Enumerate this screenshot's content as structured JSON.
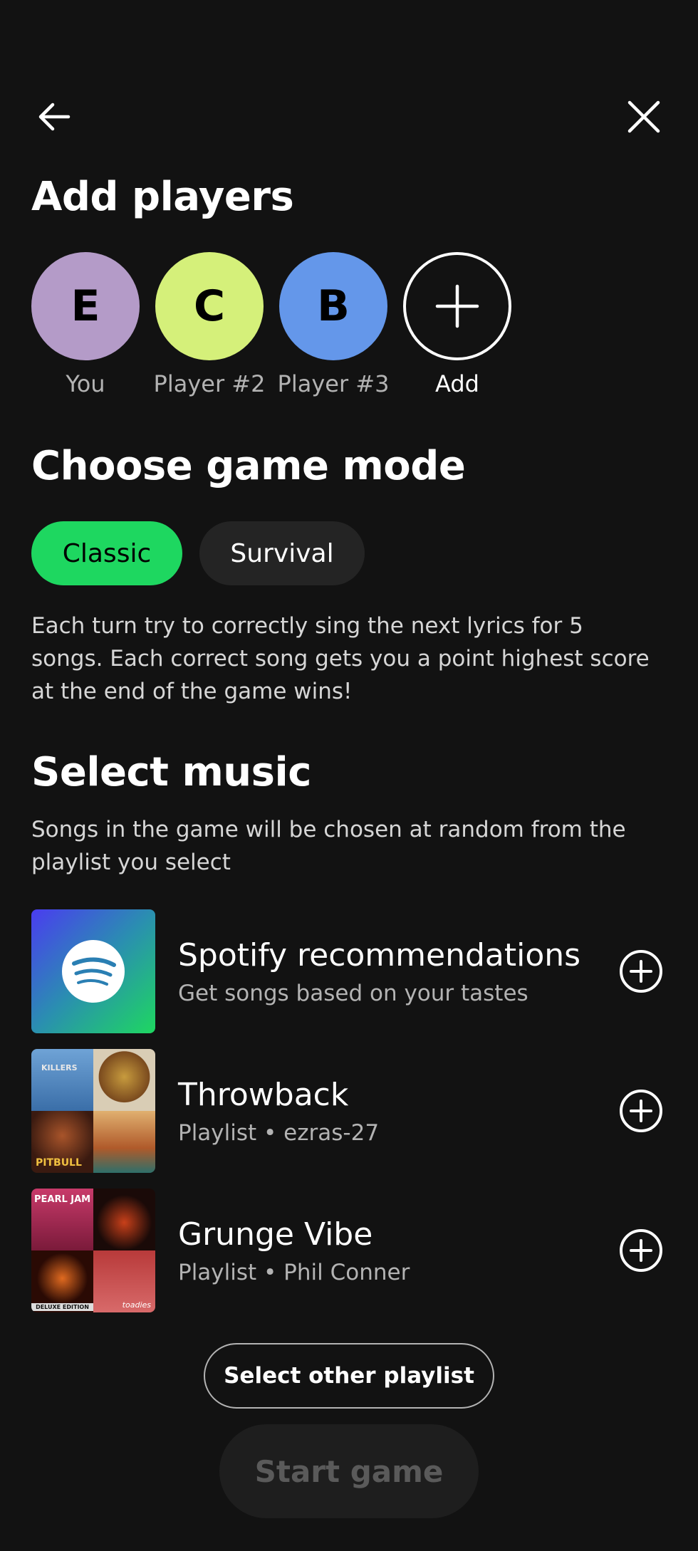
{
  "header": {
    "back_icon": "arrow-left-icon",
    "close_icon": "close-icon"
  },
  "players_section": {
    "title": "Add players",
    "players": [
      {
        "initial": "E",
        "label": "You",
        "color": "#b49bc8"
      },
      {
        "initial": "C",
        "label": "Player #2",
        "color": "#d5f07a"
      },
      {
        "initial": "B",
        "label": "Player #3",
        "color": "#6497ea"
      }
    ],
    "add_label": "Add",
    "add_icon": "plus-icon"
  },
  "mode_section": {
    "title": "Choose game mode",
    "modes": [
      {
        "label": "Classic",
        "selected": true
      },
      {
        "label": "Survival",
        "selected": false
      }
    ],
    "description": "Each turn try to correctly sing the next lyrics for 5 songs. Each correct song gets you a point highest score at the end of the game wins!"
  },
  "music_section": {
    "title": "Select music",
    "description": "Songs in the game will be chosen at random from the playlist you select",
    "playlists": [
      {
        "title": "Spotify recommendations",
        "subtitle": "Get songs based on your tastes",
        "cover_icon": "spotify-logo-icon"
      },
      {
        "title": "Throwback",
        "subtitle": "Playlist • ezras-27",
        "cover_texts": [
          "KILLERS",
          "PITBULL"
        ]
      },
      {
        "title": "Grunge Vibe",
        "subtitle": "Playlist • Phil Conner",
        "cover_texts": [
          "PEARL JAM",
          "DELUXE EDITION",
          "toadies"
        ]
      }
    ],
    "add_icon": "add-circle-icon",
    "other_button": "Select other playlist"
  },
  "start_button": "Start game",
  "colors": {
    "background": "#121212",
    "accent": "#1ed760",
    "secondary_text": "#b3b3b3"
  }
}
